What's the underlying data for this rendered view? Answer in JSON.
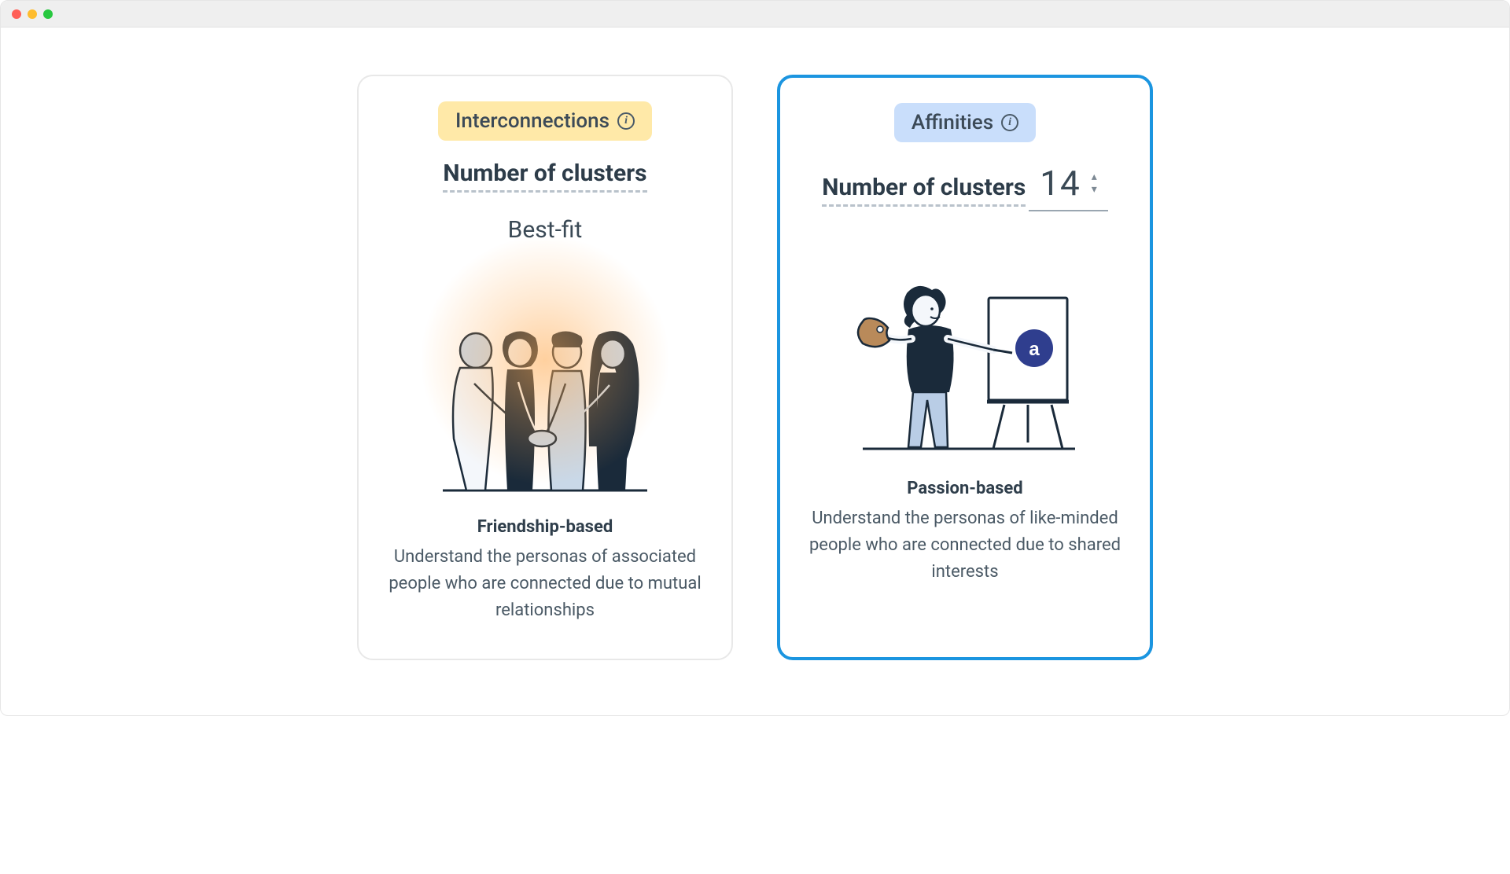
{
  "cards": {
    "interconnections": {
      "tag_label": "Interconnections",
      "section_label": "Number of clusters",
      "value_label": "Best-fit",
      "desc_title": "Friendship-based",
      "desc_body": "Understand the personas of associated people who are connected due to mutual relationships"
    },
    "affinities": {
      "tag_label": "Affinities",
      "section_label": "Number of clusters",
      "value": "14",
      "desc_title": "Passion-based",
      "desc_body": "Understand the personas of like-minded people who are connected due to shared interests"
    }
  },
  "colors": {
    "accent_blue": "#1b95e0",
    "tag_yellow": "#ffe9a8",
    "tag_blue": "#c9defb"
  }
}
